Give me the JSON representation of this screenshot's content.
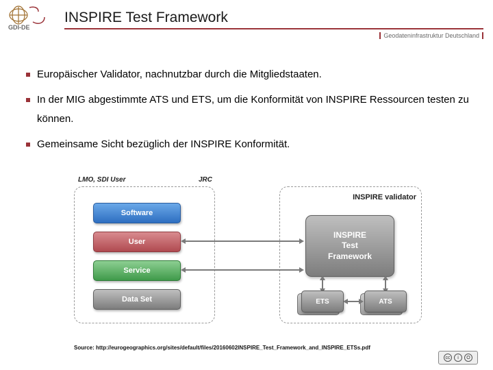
{
  "header": {
    "logo_text": "GDI-DE",
    "title": "INSPIRE Test Framework",
    "tagline": "Geodateninfrastruktur Deutschland"
  },
  "bullets": [
    "Europäischer Validator, nachnutzbar durch die Mitgliedstaaten.",
    "In der MIG abgestimmte ATS und ETS, um die Konformität von INSPIRE Ressourcen testen zu können.",
    "Gemeinsame Sicht bezüglich der INSPIRE Konformität."
  ],
  "diagram": {
    "left_label": "LMO, SDI User",
    "right_label": "JRC",
    "validator_label": "INSPIRE validator",
    "pills": {
      "software": "Software",
      "user": "User",
      "service": "Service",
      "dataset": "Data Set"
    },
    "big_box": "INSPIRE\nTest\nFramework",
    "small_ets": "ETS",
    "small_ats": "ATS"
  },
  "source": "Source: http://eurogeographics.org/sites/default/files/20160602INSPIRE_Test_Framework_and_INSPIRE_ETSs.pdf",
  "cc": [
    "cc",
    "i",
    "O"
  ]
}
